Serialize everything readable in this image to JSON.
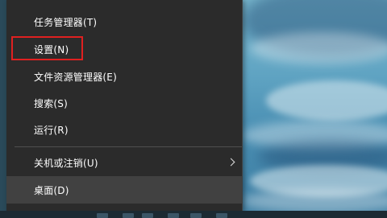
{
  "context_menu": {
    "items": [
      {
        "label": "任务管理器(T)"
      },
      {
        "label": "设置(N)"
      },
      {
        "label": "文件资源管理器(E)"
      },
      {
        "label": "搜索(S)"
      },
      {
        "label": "运行(R)"
      },
      {
        "label": "关机或注销(U)",
        "has_submenu": true
      },
      {
        "label": "桌面(D)",
        "state": "hovered"
      }
    ],
    "highlighted_item": "设置(N)",
    "colors": {
      "background": "#2b2b2b",
      "text": "#ffffff",
      "hover": "#414141",
      "highlight_border": "#e02020"
    }
  },
  "icons": {
    "submenu_indicator": "chevron-right-icon"
  }
}
